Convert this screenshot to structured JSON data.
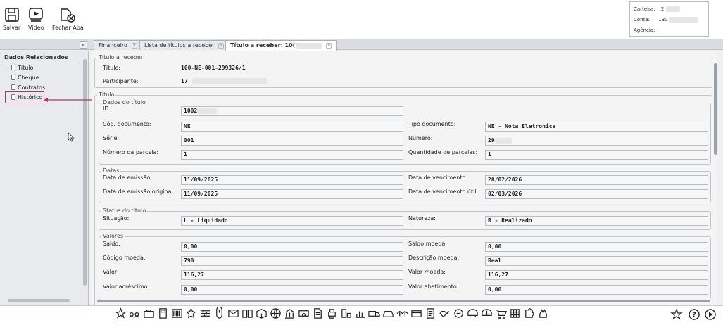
{
  "toolbar": {
    "save_label": "Salvar",
    "video_label": "Vídeo",
    "close_tab_label": "Fechar Aba"
  },
  "userbox": {
    "carteira_label": "Carteira:",
    "carteira_value": "2",
    "conta_label": "Conta:",
    "conta_value": "130",
    "agencia_label": "Agência:"
  },
  "tabs": {
    "collapse": "«",
    "items": [
      {
        "label": "Financeiro"
      },
      {
        "label": "Lista de títulos a receber"
      },
      {
        "label": "Título a receber: 10("
      }
    ]
  },
  "sidebar": {
    "title": "Dados Relacionados",
    "items": [
      {
        "label": "Título"
      },
      {
        "label": "Cheque"
      },
      {
        "label": "Contratos"
      },
      {
        "label": "Histórico"
      }
    ]
  },
  "titulo_receber": {
    "group_title": "Título a receber",
    "titulo_label": "Título:",
    "titulo_value": "100-NE-001-299326/1",
    "participante_label": "Participante:",
    "participante_value": "17"
  },
  "titulo": {
    "group_title": "Título",
    "dados": {
      "group_title": "Dados do título",
      "id_label": "ID:",
      "id_value": "1002",
      "cod_doc_label": "Cód. documento:",
      "cod_doc_value": "NE",
      "tipo_doc_label": "Tipo documento:",
      "tipo_doc_value": "NE - Nota Eletronica",
      "serie_label": "Série:",
      "serie_value": "001",
      "numero_label": "Número:",
      "numero_value": "29",
      "parcela_label": "Número da parcela:",
      "parcela_value": "1",
      "qtd_parcelas_label": "Quantidade de parcelas:",
      "qtd_parcelas_value": "1"
    },
    "datas": {
      "group_title": "Datas",
      "emissao_label": "Data de emissão:",
      "emissao_value": "11/09/2025",
      "vencimento_label": "Data de vencimento:",
      "vencimento_value": "28/02/2026",
      "emissao_orig_label": "Data de emissão original:",
      "emissao_orig_value": "11/09/2025",
      "venc_util_label": "Data de vencimento útil:",
      "venc_util_value": "02/03/2026"
    },
    "status": {
      "group_title": "Status do título",
      "situacao_label": "Situação:",
      "situacao_value": "L - Liquidado",
      "natureza_label": "Natureza:",
      "natureza_value": "R - Realizado"
    },
    "valores": {
      "group_title": "Valores",
      "saldo_label": "Saldo:",
      "saldo_value": "0,00",
      "saldo_moeda_label": "Saldo moeda:",
      "saldo_moeda_value": "0,00",
      "cod_moeda_label": "Código moeda:",
      "cod_moeda_value": "790",
      "desc_moeda_label": "Descrição moeda:",
      "desc_moeda_value": "Real",
      "valor_label": "Valor:",
      "valor_value": "116,27",
      "valor_moeda_label": "Valor moeda:",
      "valor_moeda_value": "116,27",
      "acrescimo_label": "Valor acréscimo:",
      "acrescimo_value": "0,00",
      "abatimento_label": "Valor abatimento:",
      "abatimento_value": "0,00"
    }
  },
  "colors": {
    "highlight": "#b5306f",
    "tab_active_bg": "#ffffff",
    "sidebar_bg": "#e8eaed"
  },
  "bottom_icons": [
    "star-icon",
    "people-icon",
    "briefcase-icon",
    "calculator-icon",
    "barcode-icon",
    "badge-icon",
    "sliders-icon",
    "mouse-icon",
    "mail-icon",
    "book-icon",
    "box-icon",
    "globe-icon",
    "bank-icon",
    "cash-icon",
    "document-icon",
    "printer-icon",
    "scanner-icon",
    "chart-icon",
    "truck-icon",
    "car-icon",
    "handshake-icon",
    "card-icon",
    "doc-icon",
    "hands-icon",
    "coin-icon",
    "money-icon",
    "money2-icon",
    "cart-icon",
    "table-icon",
    "puzzle-icon",
    "hand-icon"
  ]
}
